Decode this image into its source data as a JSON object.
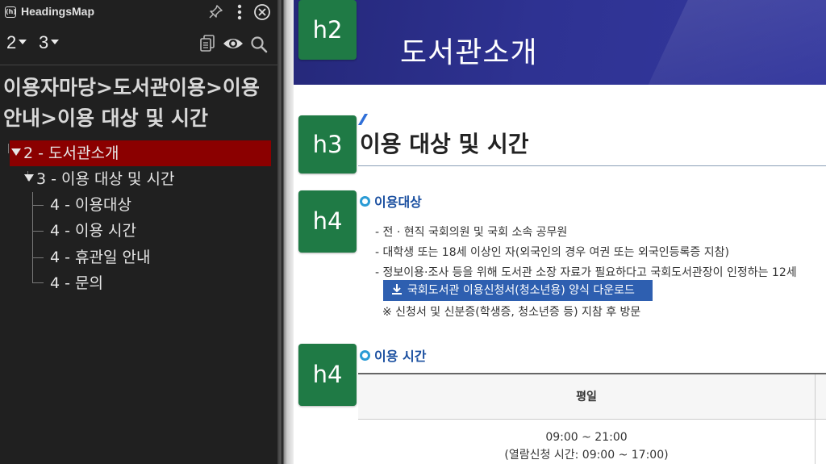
{
  "panel": {
    "app_title": "HeadingsMap",
    "app_logo": "(h)",
    "icons": [
      "pin-icon",
      "menu-icon",
      "close-icon",
      "copy-icon",
      "eye-icon",
      "search-icon"
    ],
    "levels": [
      "2",
      "3"
    ],
    "page_title_line1": "이용자마당>도서관이용>이용",
    "page_title_line2": "안내>이용 대상 및 시간",
    "tree": [
      {
        "label": "2 - 도서관소개",
        "level": 2,
        "selected": true
      },
      {
        "label": "3 - 이용 대상 및 시간",
        "level": 3,
        "selected": false
      },
      {
        "label": "4 - 이용대상",
        "level": 4,
        "selected": false
      },
      {
        "label": "4 - 이용 시간",
        "level": 4,
        "selected": false
      },
      {
        "label": "4 - 휴관일 안내",
        "level": 4,
        "selected": false
      },
      {
        "label": "4 - 문의",
        "level": 4,
        "selected": false
      }
    ]
  },
  "page": {
    "banner_title": "도서관소개",
    "section_heading": "이용 대상 및 시간",
    "target": {
      "heading": "이용대상",
      "bullets": [
        "- 전 · 현직 국회의원 및 국회 소속 공무원",
        "- 대학생 또는 18세 이상인 자(외국인의 경우 여권 또는 외국인등록증 지참)",
        "- 정보이용·조사 등을 위해 도서관 소장 자료가 필요하다고 국회도서관장이 인정하는 12세"
      ],
      "download_label": "국회도서관 이용신청서(청소년용) 양식 다운로드",
      "note": "※ 신청서 및 신분증(학생증, 청소년증 등) 지참 후 방문"
    },
    "hours": {
      "heading": "이용 시간",
      "column": "평일",
      "value": "09:00 ~ 21:00",
      "sub": "(열람신청 시간: 09:00 ~ 17:00)"
    }
  },
  "badges": [
    "h2",
    "h3",
    "h4",
    "h4"
  ],
  "colors": {
    "panel_bg": "#202020",
    "selected_bg": "#8b0000",
    "banner": "#2e3292",
    "badge": "#1f7a45",
    "accent_blue": "#1a4fa0",
    "button_blue": "#2e5fb0"
  }
}
